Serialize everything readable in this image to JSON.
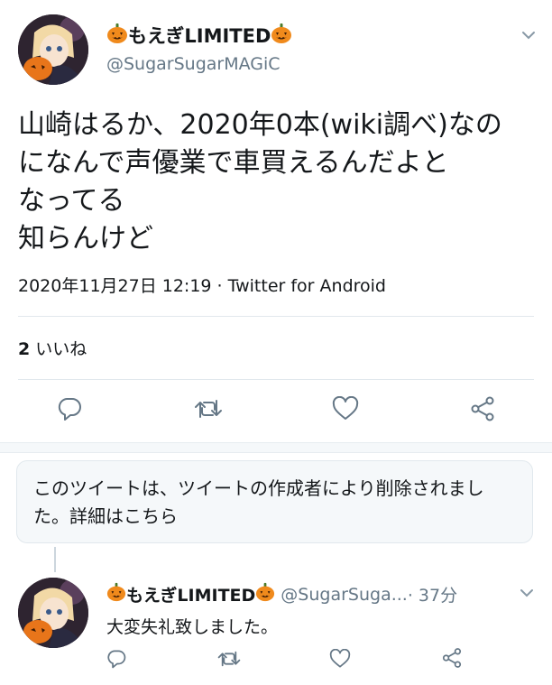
{
  "tweet": {
    "display_name": "もえぎLIMITED",
    "handle": "@SugarSugarMAGiC",
    "text": "山崎はるか、2020年0本(wiki調べ)なの\nになんで声優業で車買えるんだよと\nなってる\n知らんけど",
    "timestamp": "2020年11月27日 12:19",
    "separator": " · ",
    "source": "Twitter for Android",
    "like_count": "2",
    "like_label": "いいね"
  },
  "deleted_notice": {
    "text": "このツイートは、ツイートの作成者により削除されました。",
    "link": "詳細はこちら"
  },
  "reply": {
    "display_name": "もえぎLIMITED",
    "handle": "@SugarSuga...",
    "time": " · 37分",
    "text": "大変失礼致しました。"
  },
  "icons": [
    "chevron-down-icon",
    "reply-icon",
    "retweet-icon",
    "like-icon",
    "share-icon",
    "pumpkin-emoji-icon"
  ],
  "colors": {
    "text": "#14171a",
    "secondary": "#657786",
    "divider": "#e1e8ed",
    "background": "#ffffff"
  }
}
